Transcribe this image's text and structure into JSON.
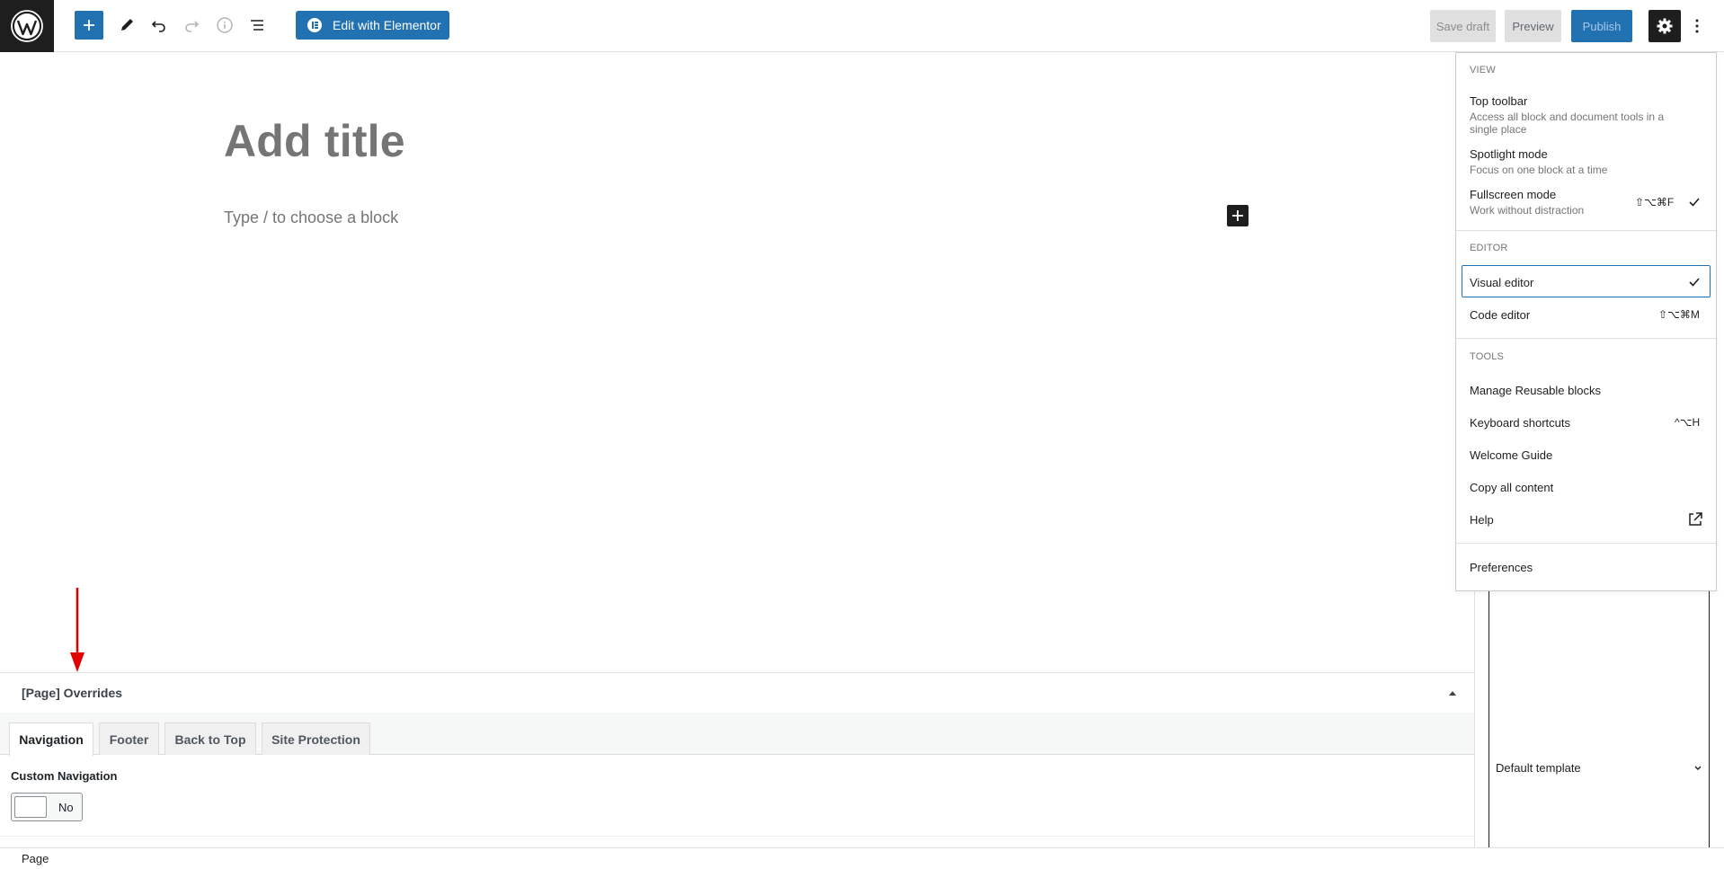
{
  "toolbar": {
    "elementor_label": "Edit with Elementor",
    "save_draft_label": "Save draft",
    "preview_label": "Preview",
    "publish_label": "Publish"
  },
  "editor": {
    "title_placeholder": "Add title",
    "block_placeholder": "Type / to choose a block"
  },
  "menu": {
    "view": {
      "label": "VIEW",
      "items": [
        {
          "title": "Top toolbar",
          "desc": "Access all block and document tools in a single place"
        },
        {
          "title": "Spotlight mode",
          "desc": "Focus on one block at a time"
        },
        {
          "title": "Fullscreen mode",
          "desc": "Work without distraction",
          "shortcut": "⇧⌥⌘F",
          "checked": true
        }
      ]
    },
    "editor": {
      "label": "EDITOR",
      "items": [
        {
          "title": "Visual editor",
          "checked": true
        },
        {
          "title": "Code editor",
          "shortcut": "⇧⌥⌘M"
        }
      ]
    },
    "tools": {
      "label": "TOOLS",
      "items": [
        {
          "title": "Manage Reusable blocks"
        },
        {
          "title": "Keyboard shortcuts",
          "shortcut": "^⌥H"
        },
        {
          "title": "Welcome Guide"
        },
        {
          "title": "Copy all content"
        },
        {
          "title": "Help"
        }
      ]
    },
    "preferences": "Preferences"
  },
  "sidebar": {
    "template": "Default template"
  },
  "metabox": {
    "title": "[Page] Overrides",
    "tabs": [
      "Navigation",
      "Footer",
      "Back to Top",
      "Site Protection"
    ],
    "active_tab": "Navigation",
    "field_label": "Custom Navigation",
    "toggle_value": "No"
  },
  "footer": {
    "breadcrumb": "Page"
  },
  "colors": {
    "accent": "#2271b1",
    "dark": "#1e1e1e",
    "annotation_arrow": "#e00000"
  }
}
